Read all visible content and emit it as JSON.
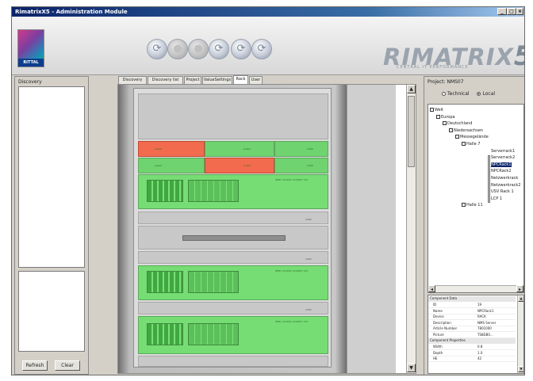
{
  "window": {
    "title": "RimatrixX5 - Administration Module"
  },
  "header": {
    "logo_text": "RITTAL",
    "brand": "RIMATRIX",
    "brand_suffix": "5",
    "brand_subtitle": "CENTRAL IT PERFORMANCE",
    "toolbar": [
      {
        "name": "refresh-tool",
        "glyph": "⟳",
        "enabled": true
      },
      {
        "name": "tool-2",
        "glyph": "●",
        "enabled": false
      },
      {
        "name": "tool-3",
        "glyph": "●",
        "enabled": false
      },
      {
        "name": "sync-tool",
        "glyph": "⟳",
        "enabled": true
      },
      {
        "name": "tool-5",
        "glyph": "⟳",
        "enabled": true
      },
      {
        "name": "tool-6",
        "glyph": "⟳",
        "enabled": true
      }
    ]
  },
  "discovery": {
    "label": "Discovery",
    "refresh_button": "Refresh",
    "clear_button": "Clear"
  },
  "tabs": [
    {
      "label": "Discovery",
      "active": false
    },
    {
      "label": "Discovery list",
      "active": false
    },
    {
      "label": "Project",
      "active": false
    },
    {
      "label": "ValueSettings",
      "active": false
    },
    {
      "label": "Rack",
      "active": true
    },
    {
      "label": "User",
      "active": false
    }
  ],
  "project": {
    "label": "Project: NMS07",
    "view_options": [
      {
        "label": "Technical",
        "selected": false
      },
      {
        "label": "Local",
        "selected": true
      }
    ],
    "tree": [
      {
        "label": "Welt",
        "level": 0,
        "selected": false
      },
      {
        "label": "Europa",
        "level": 1,
        "selected": false
      },
      {
        "label": "Deutschland",
        "level": 2,
        "selected": false
      },
      {
        "label": "Niedersachsen",
        "level": 3,
        "selected": false
      },
      {
        "label": "Messegelände",
        "level": 4,
        "selected": false
      },
      {
        "label": "Halle 7",
        "level": 5,
        "selected": false
      },
      {
        "label": "Serverrack1",
        "level": 6,
        "selected": false
      },
      {
        "label": "Serverrack2",
        "level": 6,
        "selected": false
      },
      {
        "label": "NPCRack1",
        "level": 6,
        "selected": true
      },
      {
        "label": "NPCRack2",
        "level": 6,
        "selected": false
      },
      {
        "label": "Netzwerkrack",
        "level": 6,
        "selected": false
      },
      {
        "label": "Netzwerkrack2",
        "level": 6,
        "selected": false
      },
      {
        "label": "USV Rack 1",
        "level": 6,
        "selected": false
      },
      {
        "label": "LCP 1",
        "level": 6,
        "selected": false
      },
      {
        "label": "Halle 11",
        "level": 5,
        "selected": false
      }
    ]
  },
  "properties": {
    "groups": [
      {
        "title": "Component Data",
        "rows": [
          {
            "key": "ID",
            "value": "19"
          },
          {
            "key": "Name",
            "value": "NPCRack1"
          },
          {
            "key": "Device",
            "value": "RACK"
          },
          {
            "key": "Description",
            "value": "NMS Server"
          },
          {
            "key": "Article Number",
            "value": "7801000"
          },
          {
            "key": "Picture",
            "value": "TS8DB0..."
          }
        ]
      },
      {
        "title": "Component Properties",
        "rows": [
          {
            "key": "Width",
            "value": "0.8"
          },
          {
            "key": "Depth",
            "value": "1.0"
          },
          {
            "key": "HE",
            "value": "42"
          }
        ]
      }
    ]
  },
  "rack": {
    "rows_top": [
      {
        "left_label": "power",
        "mid_label": "power",
        "right_label": "1000",
        "status": [
          "red",
          "green",
          "green"
        ]
      },
      {
        "left_label": "power",
        "mid_label": "power",
        "right_label": "1000",
        "status": [
          "green",
          "red",
          "green"
        ]
      }
    ],
    "server_caption": "IRMC 123456 1234567 123",
    "labels_small": [
      "1000",
      "1000",
      "1000"
    ]
  },
  "colors": {
    "ok": "#75dd73",
    "alarm": "#f26b4f",
    "titlebar": "#0a246a"
  }
}
